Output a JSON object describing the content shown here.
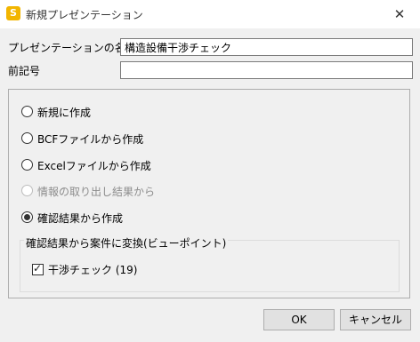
{
  "window": {
    "title": "新規プレゼンテーション",
    "app_icon_letter": "S",
    "close_glyph": "✕"
  },
  "form": {
    "name_label": "プレゼンテーションの名前",
    "name_value": "構造設備干渉チェック",
    "prefix_label": "前記号",
    "prefix_value": ""
  },
  "options": [
    {
      "label": "新規に作成",
      "selected": false,
      "enabled": true
    },
    {
      "label": "BCFファイルから作成",
      "selected": false,
      "enabled": true
    },
    {
      "label": "Excelファイルから作成",
      "selected": false,
      "enabled": true
    },
    {
      "label": "情報の取り出し結果から",
      "selected": false,
      "enabled": false
    },
    {
      "label": "確認結果から作成",
      "selected": true,
      "enabled": true
    }
  ],
  "convert_group": {
    "title": "確認結果から案件に変換(ビューポイント)",
    "item_label": "干渉チェック (19)",
    "item_checked": true,
    "check_glyph": "✓"
  },
  "buttons": {
    "ok": "OK",
    "cancel": "キャンセル"
  }
}
